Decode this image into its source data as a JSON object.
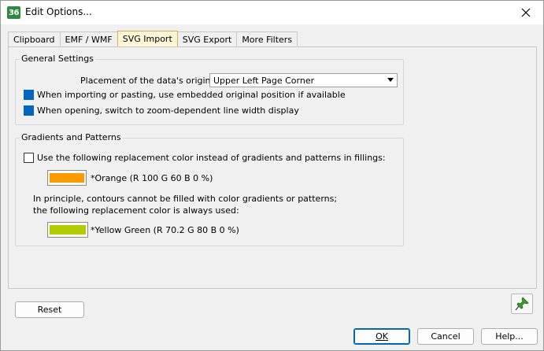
{
  "window": {
    "title": "Edit Options...",
    "app_icon_text": "36"
  },
  "tabs": [
    {
      "label": "Clipboard",
      "active": false
    },
    {
      "label": "EMF / WMF",
      "active": false
    },
    {
      "label": "SVG Import",
      "active": true
    },
    {
      "label": "SVG Export",
      "active": false
    },
    {
      "label": "More Filters",
      "active": false
    }
  ],
  "general_settings": {
    "title": "General Settings",
    "origin_label": "Placement of the data's origin:",
    "origin_value": "Upper Left Page Corner",
    "embedded_position_label": "When importing or pasting, use embedded original position if available",
    "embedded_position_checked": true,
    "zoom_line_width_label": "When opening, switch to zoom-dependent line width display",
    "zoom_line_width_checked": true
  },
  "gradients_patterns": {
    "title": "Gradients and Patterns",
    "replacement_label": "Use the following replacement color instead of gradients and patterns in fillings:",
    "replacement_checked": false,
    "fill_color_name": "*Orange (R 100 G 60 B 0 %)",
    "fill_color_hex": "#ff9900",
    "contour_note_line1": "In principle, contours cannot be filled with color gradients or patterns;",
    "contour_note_line2": "the following replacement color is always used:",
    "contour_color_name": "*Yellow Green (R 70.2 G 80 B 0 %)",
    "contour_color_hex": "#b3cc00"
  },
  "buttons": {
    "reset": "Reset",
    "ok": "OK",
    "cancel": "Cancel",
    "help": "Help..."
  },
  "icons": {
    "close": "close-icon",
    "pin": "pin-icon",
    "dropdown": "chevron-down-icon"
  }
}
